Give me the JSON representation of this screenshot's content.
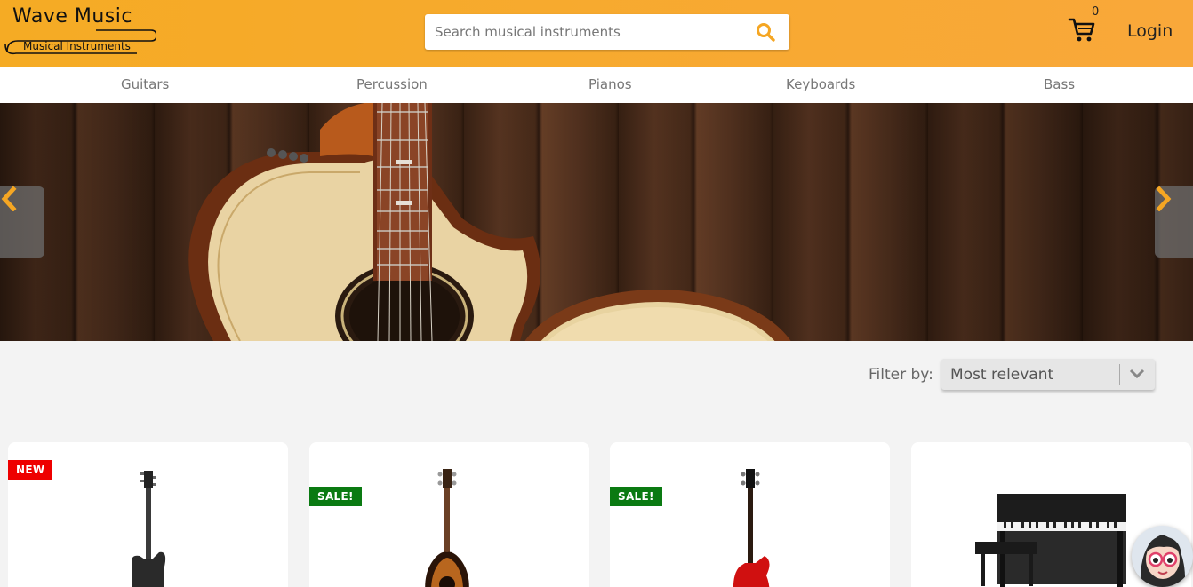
{
  "header": {
    "logo_line1": "Wave Music",
    "logo_line2": "Musical Instruments",
    "search_placeholder": "Search musical instruments",
    "search_icon": "search-icon",
    "cart_icon": "cart-icon",
    "cart_count": "0",
    "login_label": "Login",
    "accent_color": "#f5ab24"
  },
  "nav": {
    "items": [
      {
        "label": "Guitars"
      },
      {
        "label": "Percussion"
      },
      {
        "label": "Pianos"
      },
      {
        "label": "Keyboards"
      },
      {
        "label": "Bass"
      }
    ]
  },
  "hero": {
    "prev_icon": "chevron-left-icon",
    "next_icon": "chevron-right-icon",
    "arrow_color": "#f5a623"
  },
  "filter": {
    "label": "Filter by:",
    "selected": "Most relevant"
  },
  "products": [
    {
      "badge": "NEW",
      "image": "electric-guitar"
    },
    {
      "badge": "SALE!",
      "image": "acoustic-bass-guitar"
    },
    {
      "badge": "SALE!",
      "image": "red-bass-guitar"
    },
    {
      "badge": "",
      "image": "digital-piano"
    }
  ],
  "colors": {
    "badge_new": "#ee0000",
    "badge_sale": "#0a7a12"
  }
}
